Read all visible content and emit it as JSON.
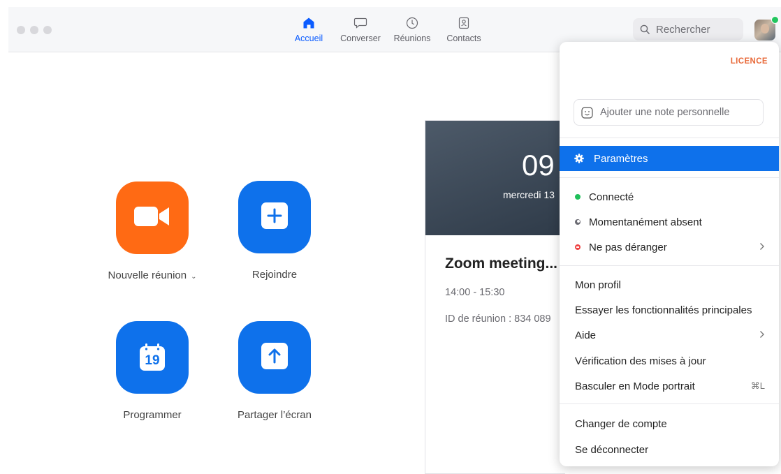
{
  "nav": {
    "items": [
      {
        "label": "Accueil",
        "icon": "home-icon",
        "active": true
      },
      {
        "label": "Converser",
        "icon": "chat-bubble-icon",
        "active": false
      },
      {
        "label": "Réunions",
        "icon": "clock-icon",
        "active": false
      },
      {
        "label": "Contacts",
        "icon": "contact-card-icon",
        "active": false
      }
    ]
  },
  "search": {
    "placeholder": "Rechercher"
  },
  "actions": {
    "new_meeting": "Nouvelle réunion",
    "join": "Rejoindre",
    "schedule": "Programmer",
    "schedule_day": "19",
    "share_screen": "Partager l’écran"
  },
  "meeting_card": {
    "time": "09",
    "date": "mercredi 13",
    "title": "Zoom meeting...",
    "hours": "14:00 - 15:30",
    "meeting_id": "ID de réunion : 834 089"
  },
  "menu": {
    "licence": "LICENCE",
    "note_placeholder": "Ajouter une note personnelle",
    "settings": "Paramètres",
    "status": {
      "connected": "Connecté",
      "away": "Momentanément absent",
      "dnd": "Ne pas déranger"
    },
    "profile": "Mon profil",
    "try_features": "Essayer les fonctionnalités principales",
    "help": "Aide",
    "check_updates": "Vérification des mises à jour",
    "portrait_mode": "Basculer en Mode portrait",
    "portrait_shortcut": "⌘L",
    "switch_account": "Changer de compte",
    "sign_out": "Se déconnecter"
  },
  "colors": {
    "accent_blue": "#0e71eb",
    "orange": "#ff6a14",
    "status_green": "#1fbf5a",
    "status_red": "#ef4444"
  }
}
